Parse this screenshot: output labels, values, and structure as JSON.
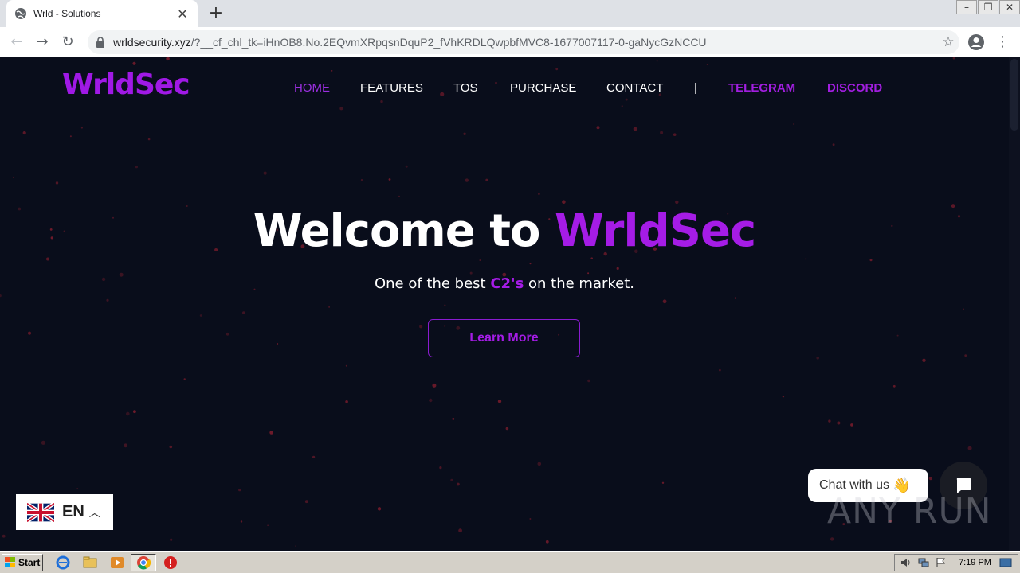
{
  "browser": {
    "tab_title": "Wrld - Solutions",
    "url_main": "wrldsecurity.xyz",
    "url_rest": "/?__cf_chl_tk=iHnOB8.No.2EQvmXRpqsnDquP2_fVhKRDLQwpbfMVC8-1677007117-0-gaNycGzNCCU"
  },
  "site": {
    "logo": "WrldSec",
    "nav": {
      "home": "HOME",
      "features": "FEATURES",
      "tos": "TOS",
      "purchase": "PURCHASE",
      "contact": "CONTACT",
      "separator": "|",
      "telegram": "TELEGRAM",
      "discord": "DISCORD"
    },
    "hero": {
      "title_prefix": "Welcome to ",
      "title_brand": "WrldSec",
      "sub_prefix": "One of the best ",
      "sub_highlight": "C2's",
      "sub_suffix": " on the market.",
      "button": "Learn More"
    },
    "language": {
      "code": "EN"
    },
    "chat": {
      "label": "Chat with us",
      "emoji": "👋"
    }
  },
  "watermark": "ANY RUN",
  "taskbar": {
    "start_label": "Start",
    "clock": "7:19 PM"
  },
  "colors": {
    "accent": "#a51ce6",
    "page_bg": "#090d1b",
    "star": "#7a1c2c"
  }
}
